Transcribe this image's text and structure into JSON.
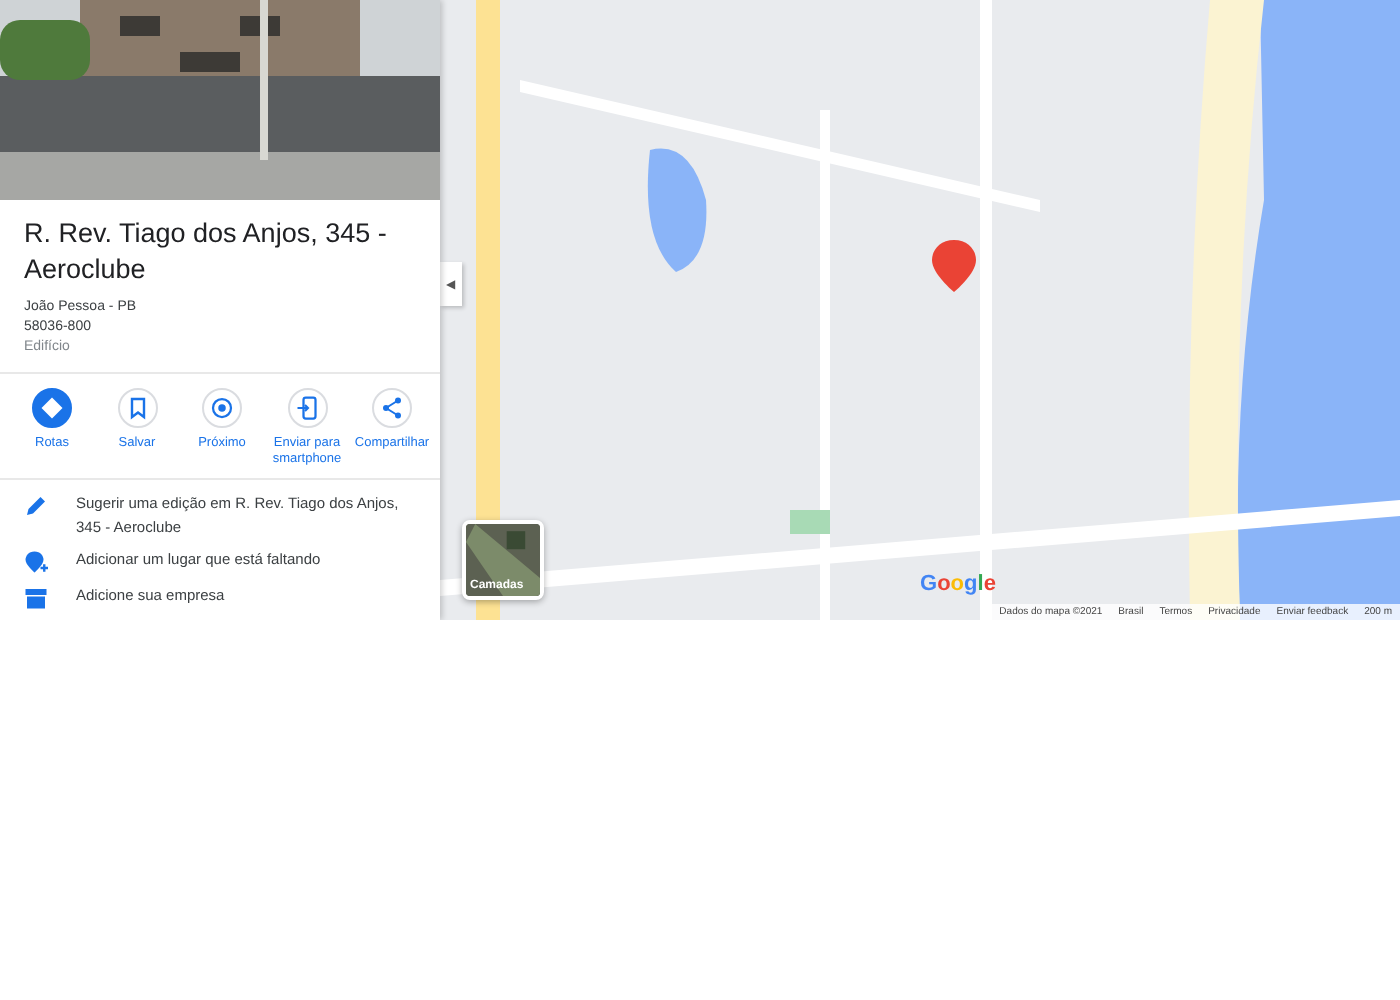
{
  "place": {
    "title": "R. Rev. Tiago dos Anjos, 345 - Aeroclube",
    "city": "João Pessoa - PB",
    "postal_code": "58036-800",
    "category": "Edifício"
  },
  "actions": [
    {
      "kind": "directions",
      "label": "Rotas",
      "primary": true
    },
    {
      "kind": "save",
      "label": "Salvar",
      "primary": false
    },
    {
      "kind": "nearby",
      "label": "Próximo",
      "primary": false
    },
    {
      "kind": "phone",
      "label": "Enviar para smartphone",
      "primary": false
    },
    {
      "kind": "share",
      "label": "Compartilhar",
      "primary": false
    }
  ],
  "suggestions": [
    {
      "kind": "edit",
      "text": "Sugerir uma edição em R. Rev. Tiago dos Anjos, 345 - Aeroclube"
    },
    {
      "kind": "add-place",
      "text": "Adicionar um lugar que está faltando"
    },
    {
      "kind": "business",
      "text": "Adicione sua empresa"
    }
  ],
  "collapse_arrow": "◀",
  "layers_button": "Camadas",
  "map_logo": "Google",
  "map_footer": [
    "Dados do mapa ©2021",
    "Brasil",
    "Termos",
    "Privacidade",
    "Enviar feedback",
    "200 m"
  ]
}
